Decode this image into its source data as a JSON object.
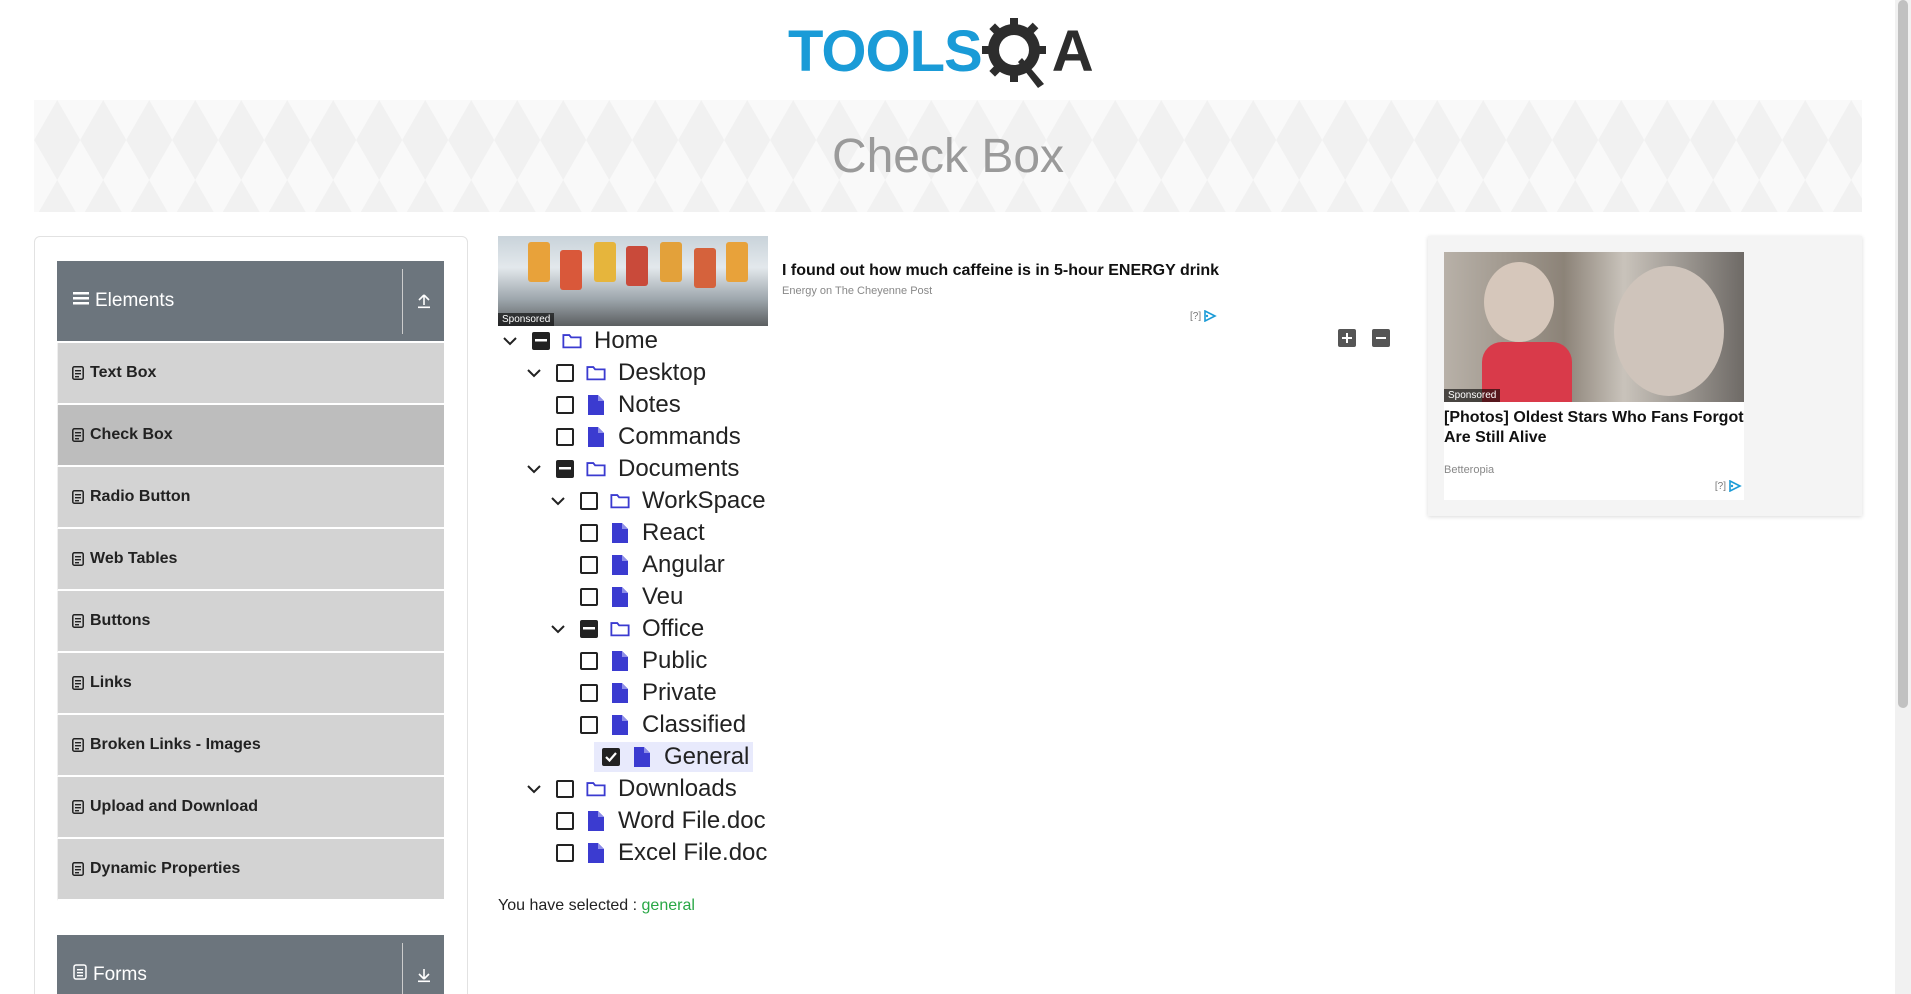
{
  "logo": {
    "tools": "TOOLS",
    "qa": "A"
  },
  "banner": {
    "title": "Check Box"
  },
  "sidebar": {
    "elements_header": "Elements",
    "items": [
      {
        "label": "Text Box"
      },
      {
        "label": "Check Box"
      },
      {
        "label": "Radio Button"
      },
      {
        "label": "Web Tables"
      },
      {
        "label": "Buttons"
      },
      {
        "label": "Links"
      },
      {
        "label": "Broken Links - Images"
      },
      {
        "label": "Upload and Download"
      },
      {
        "label": "Dynamic Properties"
      }
    ],
    "forms_header": "Forms"
  },
  "ad_top": {
    "sponsored": "Sponsored",
    "title": "I found out how much caffeine is in 5-hour ENERGY drink",
    "source": "Energy on The Cheyenne Post",
    "choice": "[?]"
  },
  "tree": {
    "home": "Home",
    "desktop": "Desktop",
    "notes": "Notes",
    "commands": "Commands",
    "documents": "Documents",
    "workspace": "WorkSpace",
    "react": "React",
    "angular": "Angular",
    "veu": "Veu",
    "office": "Office",
    "public": "Public",
    "private": "Private",
    "classified": "Classified",
    "general": "General",
    "downloads": "Downloads",
    "wordfile": "Word File.doc",
    "excelfile": "Excel File.doc"
  },
  "result": {
    "prefix": "You have selected : ",
    "value": "general"
  },
  "ad_right": {
    "sponsored": "Sponsored",
    "title": "[Photos] Oldest Stars Who Fans Forgot Are Still Alive",
    "source": "Betteropia",
    "choice": "[?]"
  },
  "colors": {
    "accent": "#1a9bd7",
    "header_gray": "#6c757d",
    "file_icon": "#3b3bd0",
    "success": "#28a745"
  }
}
